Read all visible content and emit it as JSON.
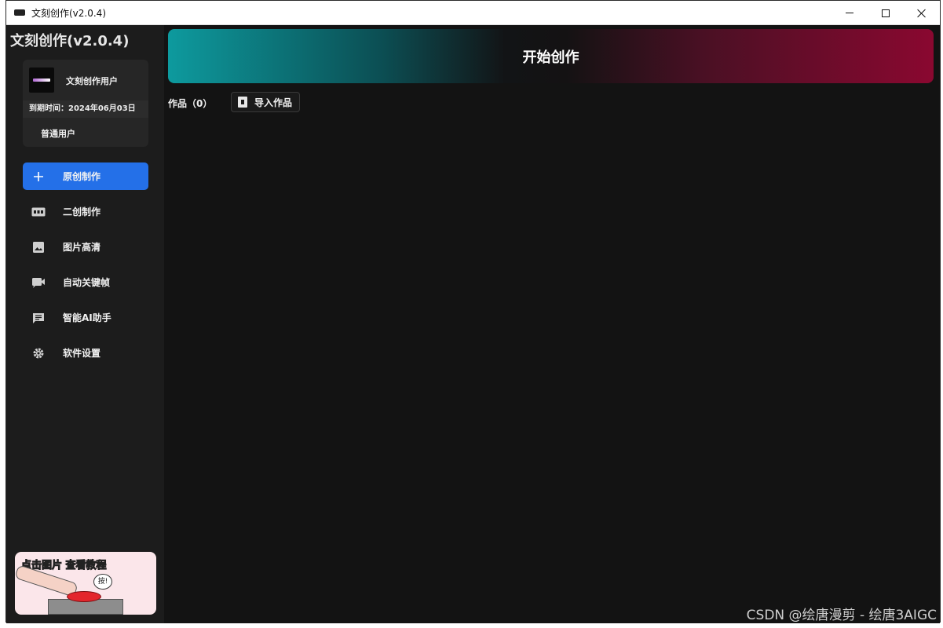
{
  "window": {
    "title": "文刻创作(v2.0.4)"
  },
  "sidebar": {
    "brand": "文刻创作(v2.0.4)",
    "user": {
      "name": "文刻创作用户",
      "expiry": "到期时间：2024年06月03日",
      "role": "普通用户"
    },
    "items": [
      {
        "label": "原创制作",
        "icon": "plus-icon",
        "active": true
      },
      {
        "label": "二创制作",
        "icon": "nfo-icon",
        "active": false
      },
      {
        "label": "图片高清",
        "icon": "image-icon",
        "active": false
      },
      {
        "label": "自动关键帧",
        "icon": "video-icon",
        "active": false
      },
      {
        "label": "智能AI助手",
        "icon": "chat-icon",
        "active": false
      },
      {
        "label": "软件设置",
        "icon": "gear-icon",
        "active": false
      }
    ],
    "promo": {
      "text": "点击图片 查看教程",
      "bubble": "按!"
    }
  },
  "main": {
    "banner_title": "开始创作",
    "works_label": "作品（0）",
    "import_label": "导入作品"
  },
  "watermark": "CSDN @绘唐漫剪 - 绘唐3AIGC",
  "colors": {
    "accent": "#2470e8",
    "banner_left": "#0d9a9e",
    "banner_right": "#8a0830",
    "sidebar_bg": "#1c1c1c",
    "main_bg": "#131313"
  }
}
